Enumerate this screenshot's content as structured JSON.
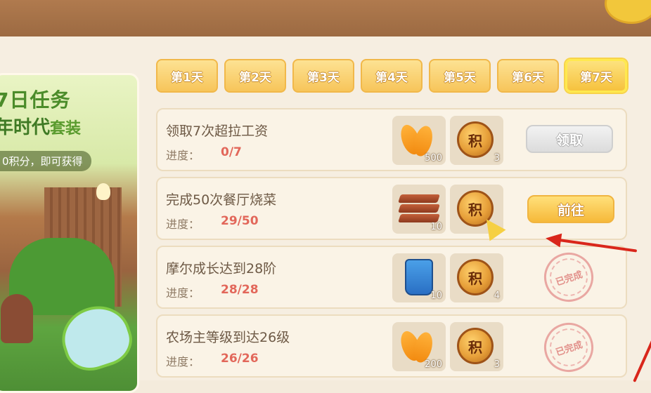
{
  "banner": {
    "title_line1": "7日任务",
    "title_line2_main": "年时代",
    "title_line2_suffix": "套装",
    "subtitle": "0积分，即可获得"
  },
  "tabs": [
    {
      "label": "第1天",
      "active": false
    },
    {
      "label": "第2天",
      "active": false
    },
    {
      "label": "第3天",
      "active": false
    },
    {
      "label": "第4天",
      "active": false
    },
    {
      "label": "第5天",
      "active": false
    },
    {
      "label": "第6天",
      "active": false
    },
    {
      "label": "第7天",
      "active": true
    }
  ],
  "progress_label": "进度：",
  "coin_glyph": "积",
  "tasks": [
    {
      "title": "领取7次超拉工资",
      "progress": "0/7",
      "rewards": [
        {
          "icon": "chips-icon",
          "qty": "500"
        },
        {
          "icon": "points-coin-icon",
          "qty": "3"
        }
      ],
      "status": "disabled",
      "button": "领取"
    },
    {
      "title": "完成50次餐厅烧菜",
      "progress": "29/50",
      "rewards": [
        {
          "icon": "wood-planks-icon",
          "qty": "10"
        },
        {
          "icon": "points-coin-icon",
          "qty": ""
        }
      ],
      "status": "go",
      "button": "前往"
    },
    {
      "title": "摩尔成长达到28阶",
      "progress": "28/28",
      "rewards": [
        {
          "icon": "seed-bag-icon",
          "qty": "10"
        },
        {
          "icon": "points-coin-icon",
          "qty": "4"
        }
      ],
      "status": "completed",
      "stamp": "已完成"
    },
    {
      "title": "农场主等级到达26级",
      "progress": "26/26",
      "rewards": [
        {
          "icon": "chips-icon",
          "qty": "200"
        },
        {
          "icon": "points-coin-icon",
          "qty": "3"
        }
      ],
      "status": "completed",
      "stamp": "已完成"
    }
  ],
  "colors": {
    "accent": "#f6c23e",
    "progress_text": "#e2675a",
    "annotation_arrow": "#d9261b"
  }
}
